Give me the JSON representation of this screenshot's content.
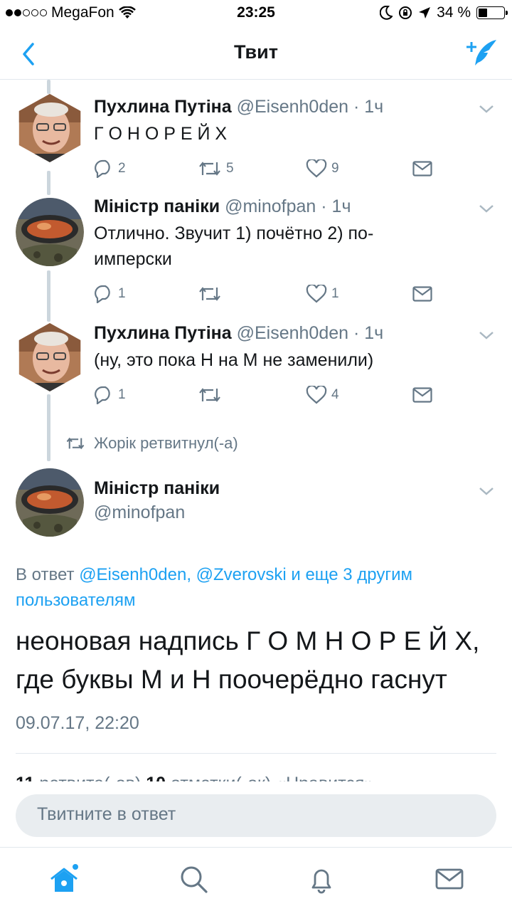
{
  "status": {
    "carrier": "MegaFon",
    "time": "23:25",
    "battery": "34 %",
    "battery_level": 0.34
  },
  "nav": {
    "title": "Твит"
  },
  "thread": [
    {
      "name": "Пухлина Путіна",
      "handle": "@Eisenh0den",
      "time": "· 1ч",
      "text": "Г О Н О Р Е Й Х",
      "replies": "2",
      "retweets": "5",
      "likes": "9"
    },
    {
      "name": "Міністр паніки",
      "handle": "@minofpan",
      "time": "· 1ч",
      "text": "Отлично. Звучит 1) почётно 2) по-имперски",
      "replies": "1",
      "retweets": "",
      "likes": "1"
    },
    {
      "name": "Пухлина Путіна",
      "handle": "@Eisenh0den",
      "time": "· 1ч",
      "text": "(ну, это пока Н на М не заменили)",
      "replies": "1",
      "retweets": "",
      "likes": "4"
    }
  ],
  "retweeted_by": "Жорік ретвитнул(-а)",
  "main": {
    "name": "Міністр паніки",
    "handle": "@minofpan",
    "reply_prefix": "В ответ ",
    "reply_mentions": "@Eisenh0den, @Zverovski и еще 3 другим пользователям",
    "text": "неоновая надпись Г О М Н О Р Е Й Х, где буквы М и Н поочерёдно гаснут",
    "timestamp": "09.07.17, 22:20",
    "stats": {
      "retweets_count": "11",
      "retweets_label": " ретвита(-ов)  ",
      "likes_count": "10",
      "likes_label": " отметки(-ок) «Нравится»"
    }
  },
  "reply_placeholder": "Твитните в ответ",
  "colors": {
    "accent": "#1da1f2",
    "muted": "#657786",
    "text": "#14171a"
  },
  "icons": [
    "back-icon",
    "compose-tweet-icon",
    "reply-icon",
    "retweet-icon",
    "like-icon",
    "message-icon",
    "chevron-down-icon",
    "home-icon",
    "search-icon",
    "notifications-icon",
    "messages-icon"
  ]
}
